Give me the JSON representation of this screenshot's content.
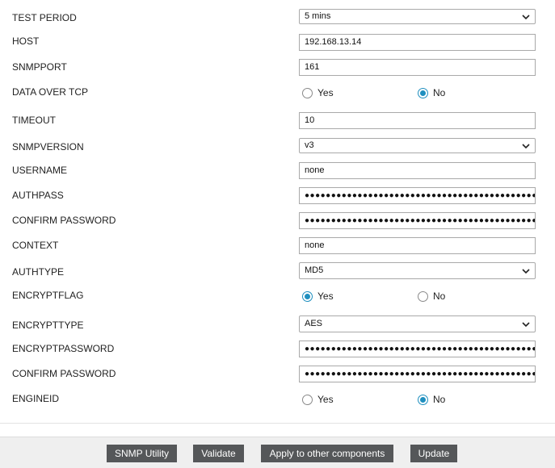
{
  "form": {
    "test_period": {
      "label": "TEST PERIOD",
      "value": "5 mins"
    },
    "host": {
      "label": "HOST",
      "value": "192.168.13.14"
    },
    "snmpport": {
      "label": "SNMPPORT",
      "value": "161"
    },
    "data_over_tcp": {
      "label": "DATA OVER TCP",
      "yes": "Yes",
      "no": "No",
      "selected": "No"
    },
    "timeout": {
      "label": "TIMEOUT",
      "value": "10"
    },
    "snmpversion": {
      "label": "SNMPVERSION",
      "value": "v3"
    },
    "username": {
      "label": "USERNAME",
      "value": "none"
    },
    "authpass": {
      "label": "AUTHPASS",
      "value": "●●●●●●●●●●●●●●●●●●●●●●●●●●●●●●●●●●●●●●●●●●●●●●●●●"
    },
    "confirm_password_1": {
      "label": "CONFIRM PASSWORD",
      "value": "●●●●●●●●●●●●●●●●●●●●●●●●●●●●●●●●●●●●●●●●●●●●●●●●●"
    },
    "context": {
      "label": "CONTEXT",
      "value": "none"
    },
    "authtype": {
      "label": "AUTHTYPE",
      "value": "MD5"
    },
    "encryptflag": {
      "label": "ENCRYPTFLAG",
      "yes": "Yes",
      "no": "No",
      "selected": "Yes"
    },
    "encrypttype": {
      "label": "ENCRYPTTYPE",
      "value": "AES"
    },
    "encryptpassword": {
      "label": "ENCRYPTPASSWORD",
      "value": "●●●●●●●●●●●●●●●●●●●●●●●●●●●●●●●●●●●●●●●●●●●●●●●●●"
    },
    "confirm_password_2": {
      "label": "CONFIRM PASSWORD",
      "value": "●●●●●●●●●●●●●●●●●●●●●●●●●●●●●●●●●●●●●●●●●●●●●●●●●"
    },
    "engineid": {
      "label": "ENGINEID",
      "yes": "Yes",
      "no": "No",
      "selected": "No"
    }
  },
  "footer": {
    "snmp_utility": "SNMP Utility",
    "validate": "Validate",
    "apply_other": "Apply to other components",
    "update": "Update"
  },
  "colors": {
    "accent": "#1f8fbf",
    "button_bg": "#555759"
  },
  "icons": {
    "select_arrow": "chevron-down-icon"
  }
}
